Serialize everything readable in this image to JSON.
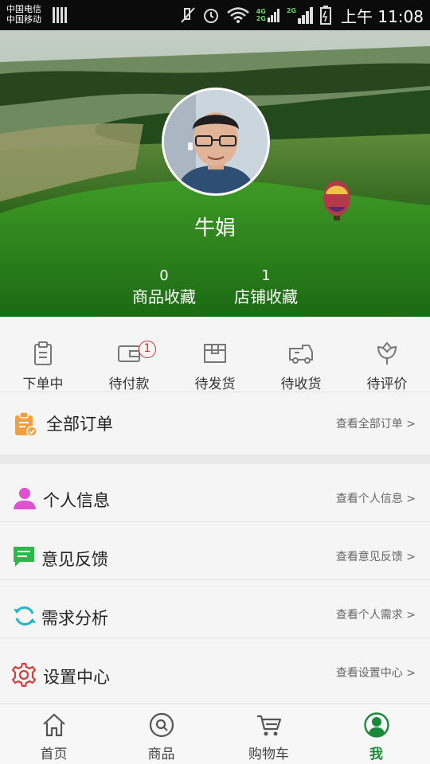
{
  "status_bar": {
    "carrier_1": "中国电信",
    "carrier_2": "中国移动",
    "net_top": "4G",
    "net_bottom": "2G",
    "net_top_2": "2G",
    "time": "上午 11:08"
  },
  "profile": {
    "name": "牛娟",
    "stats": [
      {
        "count": "0",
        "label": "商品收藏"
      },
      {
        "count": "1",
        "label": "店铺收藏"
      }
    ]
  },
  "order_status": [
    {
      "label": "下单中",
      "icon": "clipboard-icon"
    },
    {
      "label": "待付款",
      "icon": "wallet-icon",
      "badge": "1"
    },
    {
      "label": "待发货",
      "icon": "box-icon"
    },
    {
      "label": "待收货",
      "icon": "truck-icon"
    },
    {
      "label": "待评价",
      "icon": "flower-icon"
    }
  ],
  "all_orders": {
    "title": "全部订单",
    "more": "查看全部订单",
    "icon": "order-icon"
  },
  "menu": [
    {
      "title": "个人信息",
      "more": "查看个人信息",
      "icon": "person-icon"
    },
    {
      "title": "意见反馈",
      "more": "查看意见反馈",
      "icon": "chat-icon"
    },
    {
      "title": "需求分析",
      "more": "查看个人需求",
      "icon": "refresh-icon"
    },
    {
      "title": "设置中心",
      "more": "查看设置中心",
      "icon": "gear-icon"
    }
  ],
  "chevron": ">",
  "bottom_nav": [
    {
      "label": "首页",
      "icon": "home-icon"
    },
    {
      "label": "商品",
      "icon": "search-icon"
    },
    {
      "label": "购物车",
      "icon": "cart-icon"
    },
    {
      "label": "我",
      "icon": "user-icon",
      "active": true
    }
  ],
  "colors": {
    "accent": "#1a8a3a",
    "badge": "#d32d2d",
    "order_icon": "#f0a040",
    "person_icon": "#e050d0",
    "chat_icon": "#2fb84a",
    "refresh_icon": "#22b5c8",
    "gear_icon": "#d63a3a"
  }
}
